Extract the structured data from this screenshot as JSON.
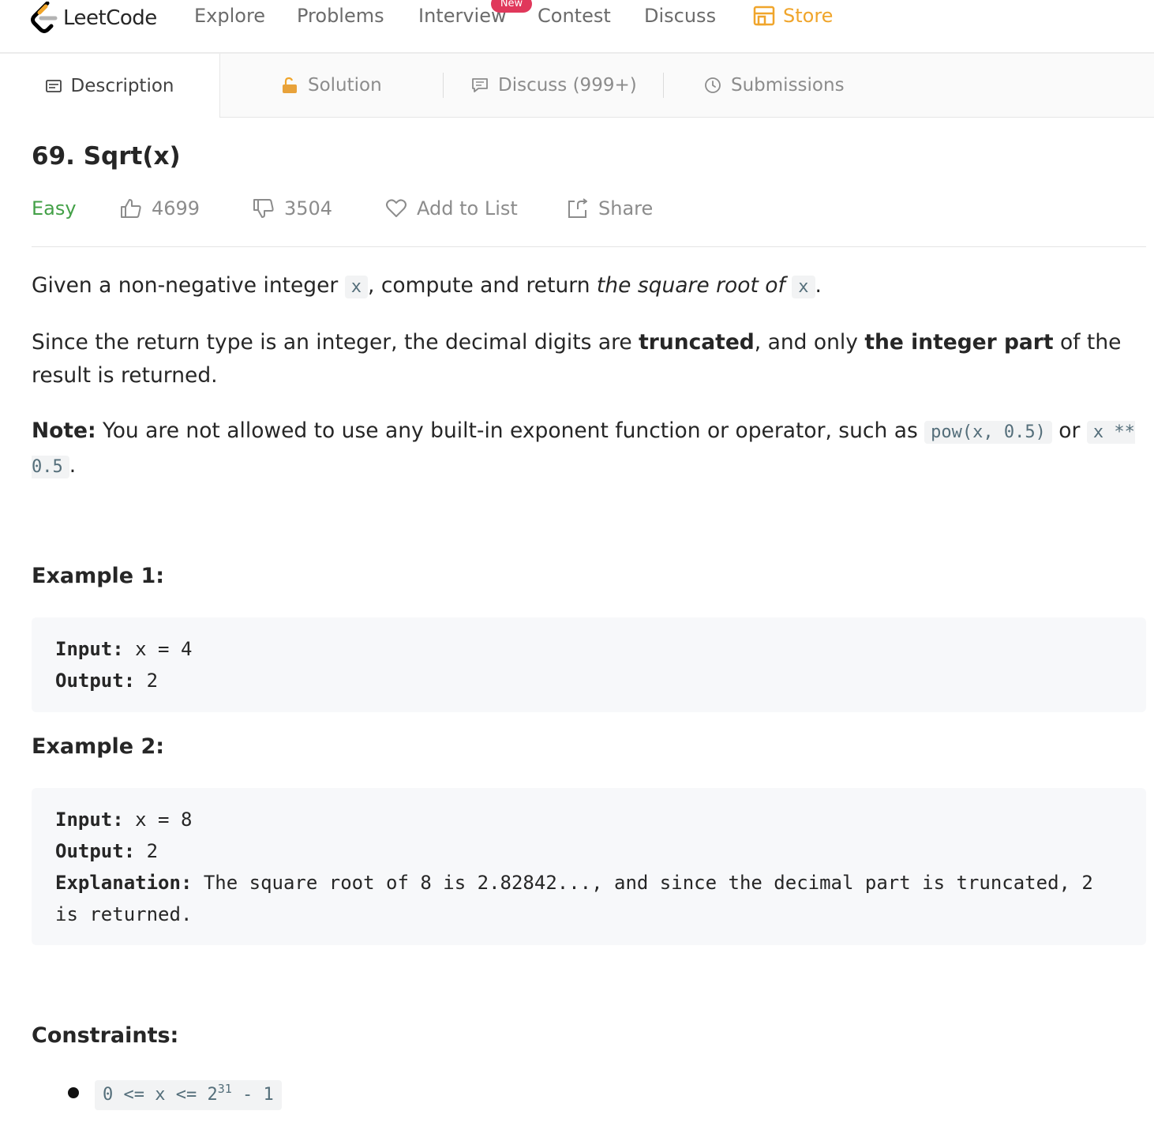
{
  "nav": {
    "logo_text": "LeetCode",
    "explore": "Explore",
    "problems": "Problems",
    "interview": "Interview",
    "new_badge": "New",
    "contest": "Contest",
    "discuss": "Discuss",
    "store": "Store"
  },
  "tabs": {
    "description": "Description",
    "solution": "Solution",
    "discuss": "Discuss (999+)",
    "submissions": "Submissions"
  },
  "problem": {
    "title": "69. Sqrt(x)",
    "difficulty": "Easy",
    "likes": "4699",
    "dislikes": "3504",
    "add_to_list": "Add to List",
    "share": "Share"
  },
  "description": {
    "p1_a": "Given a non-negative integer ",
    "p1_code1": "x",
    "p1_b": ", compute and return ",
    "p1_em": "the square root of",
    "p1_code2": "x",
    "p1_c": ".",
    "p2_a": "Since the return type is an integer, the decimal digits are ",
    "p2_strong1": "truncated",
    "p2_b": ", and only ",
    "p2_strong2": "the integer part",
    "p2_c": " of the result is returned.",
    "note_label": "Note:",
    "note_a": " You are not allowed to use any built-in exponent function or operator, such as ",
    "note_code1": "pow(x, 0.5)",
    "note_or": " or ",
    "note_code2": "x ** 0.5",
    "note_end": "."
  },
  "examples": [
    {
      "heading": "Example 1:",
      "input_label": "Input:",
      "input": " x = 4",
      "output_label": "Output:",
      "output": " 2"
    },
    {
      "heading": "Example 2:",
      "input_label": "Input:",
      "input": " x = 8",
      "output_label": "Output:",
      "output": " 2",
      "explanation_label": "Explanation:",
      "explanation": " The square root of 8 is 2.82842..., and since the decimal part is truncated, 2 is returned."
    }
  ],
  "constraints": {
    "heading": "Constraints:",
    "item_base": "0 <= x <= 2",
    "item_exp": "31",
    "item_tail": " - 1"
  },
  "colors": {
    "easy": "#43a047",
    "store": "#f0a52b",
    "new_badge": "#e0385b",
    "inline_code_bg": "#f2f3f4",
    "pre_bg": "#f7f8fa"
  }
}
